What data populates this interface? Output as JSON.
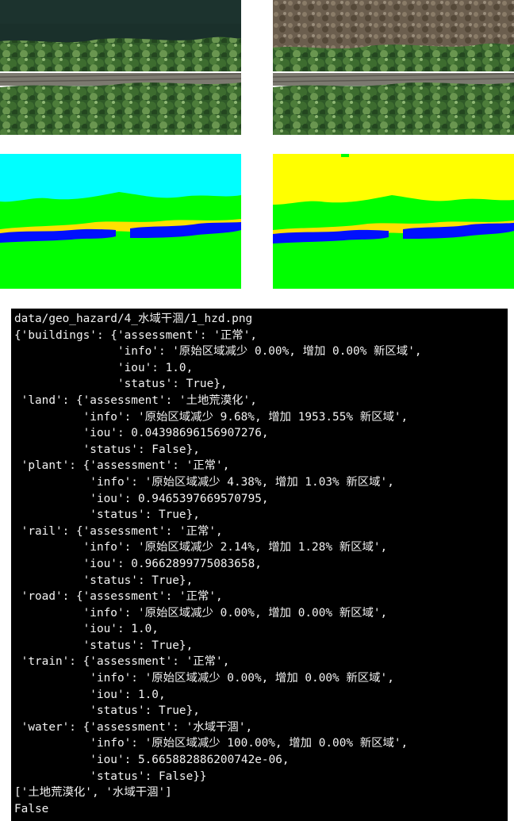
{
  "colors": {
    "terminal_bg": "#000000",
    "terminal_text": "#f2f2f2",
    "mask_water": "#00ffff",
    "mask_land": "#ffff00",
    "mask_plant": "#00ff00",
    "mask_rail": "#0010ff",
    "mask_sand": "#ffe000"
  },
  "images": {
    "photo_before_icon": "aerial-photo-river-full",
    "photo_after_icon": "aerial-photo-river-dried",
    "mask_before_icon": "segmentation-mask-before",
    "mask_after_icon": "segmentation-mask-after"
  },
  "terminal": {
    "lines": [
      "data/geo_hazard/4_水域干涸/1_hzd.png",
      "{'buildings': {'assessment': '正常',",
      "               'info': '原始区域减少 0.00%, 增加 0.00% 新区域',",
      "               'iou': 1.0,",
      "               'status': True},",
      " 'land': {'assessment': '土地荒漠化',",
      "          'info': '原始区域减少 9.68%, 增加 1953.55% 新区域',",
      "          'iou': 0.04398696156907276,",
      "          'status': False},",
      " 'plant': {'assessment': '正常',",
      "           'info': '原始区域减少 4.38%, 增加 1.03% 新区域',",
      "           'iou': 0.9465397669570795,",
      "           'status': True},",
      " 'rail': {'assessment': '正常',",
      "          'info': '原始区域减少 2.14%, 增加 1.28% 新区域',",
      "          'iou': 0.9662899775083658,",
      "          'status': True},",
      " 'road': {'assessment': '正常',",
      "          'info': '原始区域减少 0.00%, 增加 0.00% 新区域',",
      "          'iou': 1.0,",
      "          'status': True},",
      " 'train': {'assessment': '正常',",
      "           'info': '原始区域减少 0.00%, 增加 0.00% 新区域',",
      "           'iou': 1.0,",
      "           'status': True},",
      " 'water': {'assessment': '水域干涸',",
      "           'info': '原始区域减少 100.00%, 增加 0.00% 新区域',",
      "           'iou': 5.665882886200742e-06,",
      "           'status': False}}",
      "['土地荒漠化', '水域干涸']",
      "False"
    ]
  }
}
